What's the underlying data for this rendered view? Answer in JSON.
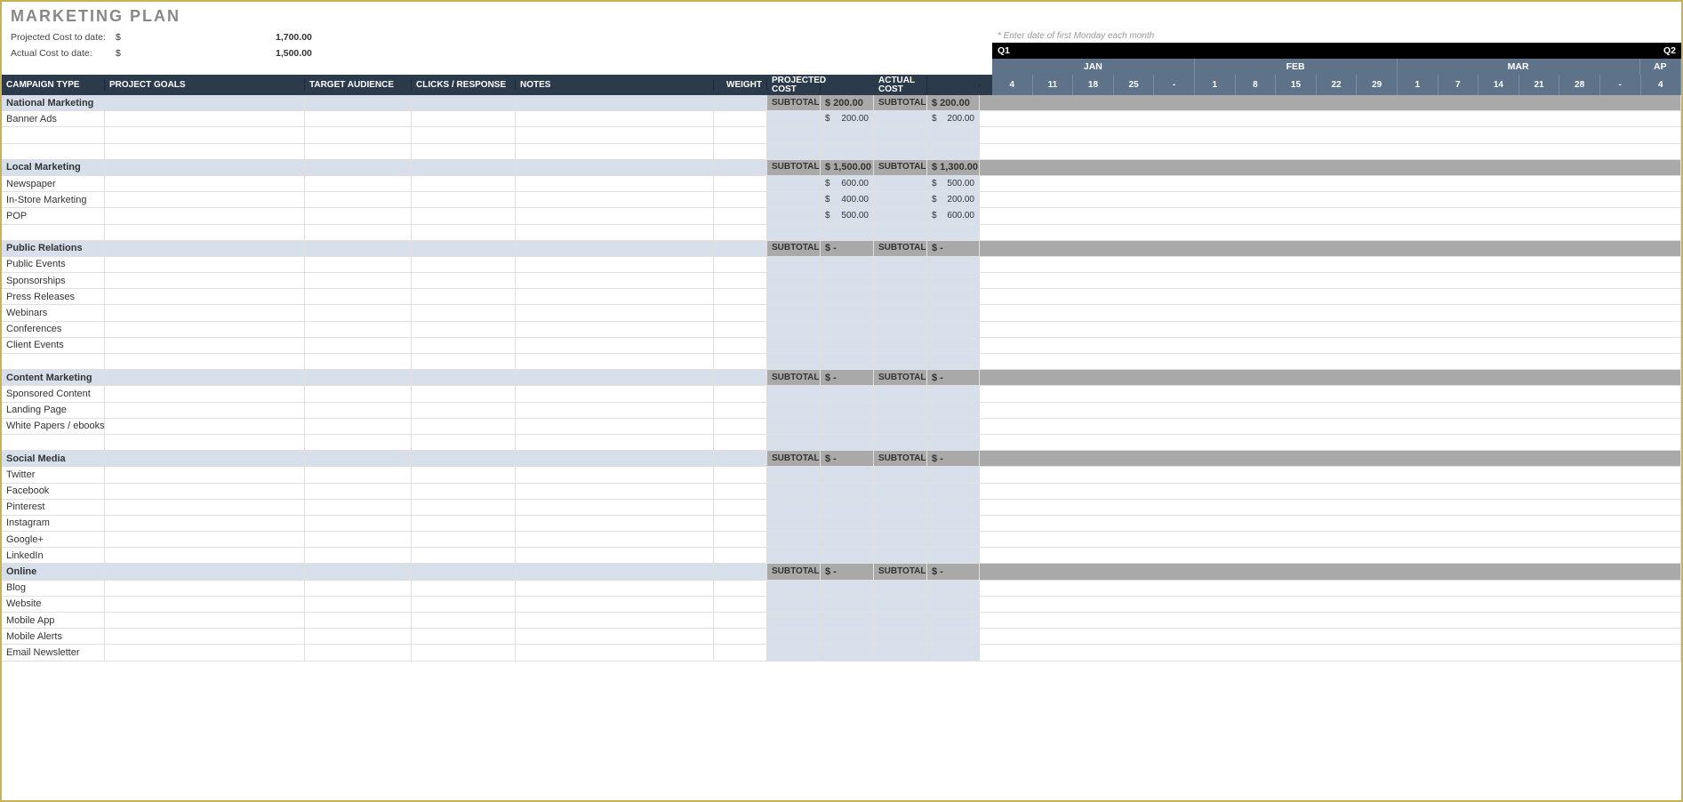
{
  "title": "MARKETING PLAN",
  "summary": {
    "projected_label": "Projected Cost to date:",
    "projected_sym": "$",
    "projected_val": "1,700.00",
    "actual_label": "Actual Cost to date:",
    "actual_sym": "$",
    "actual_val": "1,500.00"
  },
  "right_note": "* Enter date of first Monday each month",
  "quarter_left": "Q1",
  "quarter_right": "Q2",
  "months": [
    "JAN",
    "FEB",
    "MAR",
    "AP"
  ],
  "days": [
    "4",
    "11",
    "18",
    "25",
    "-",
    "1",
    "8",
    "15",
    "22",
    "29",
    "1",
    "7",
    "14",
    "21",
    "28",
    "-",
    "4"
  ],
  "headers": {
    "campaign": "CAMPAIGN TYPE",
    "goals": "PROJECT GOALS",
    "audience": "TARGET AUDIENCE",
    "clicks": "CLICKS / RESPONSE",
    "notes": "NOTES",
    "weight": "WEIGHT",
    "projcost": "PROJECTED COST",
    "actcost": "ACTUAL COST",
    "subtotal": "SUBTOTAL"
  },
  "sections": [
    {
      "name": "National Marketing",
      "proj": "$   200.00",
      "act": "$   200.00",
      "items": [
        {
          "name": "Banner Ads",
          "proj": "200.00",
          "act": "200.00"
        },
        {
          "name": ""
        },
        {
          "name": ""
        }
      ]
    },
    {
      "name": "Local Marketing",
      "proj": "$  1,500.00",
      "act": "$  1,300.00",
      "items": [
        {
          "name": "Newspaper",
          "proj": "600.00",
          "act": "500.00"
        },
        {
          "name": "In-Store Marketing",
          "proj": "400.00",
          "act": "200.00"
        },
        {
          "name": "POP",
          "proj": "500.00",
          "act": "600.00"
        },
        {
          "name": ""
        }
      ]
    },
    {
      "name": "Public Relations",
      "proj": "$           -",
      "act": "$           -",
      "items": [
        {
          "name": "Public Events"
        },
        {
          "name": "Sponsorships"
        },
        {
          "name": "Press Releases"
        },
        {
          "name": "Webinars"
        },
        {
          "name": "Conferences"
        },
        {
          "name": "Client Events"
        },
        {
          "name": ""
        }
      ]
    },
    {
      "name": "Content Marketing",
      "proj": "$           -",
      "act": "$           -",
      "items": [
        {
          "name": "Sponsored Content"
        },
        {
          "name": "Landing Page"
        },
        {
          "name": "White Papers / ebooks"
        },
        {
          "name": ""
        }
      ]
    },
    {
      "name": "Social Media",
      "proj": "$           -",
      "act": "$           -",
      "items": [
        {
          "name": "Twitter"
        },
        {
          "name": "Facebook"
        },
        {
          "name": "Pinterest"
        },
        {
          "name": "Instagram"
        },
        {
          "name": "Google+"
        },
        {
          "name": "LinkedIn"
        }
      ]
    },
    {
      "name": "Online",
      "proj": "$           -",
      "act": "$           -",
      "items": [
        {
          "name": "Blog"
        },
        {
          "name": "Website"
        },
        {
          "name": "Mobile App"
        },
        {
          "name": "Mobile Alerts"
        },
        {
          "name": "Email Newsletter"
        }
      ]
    }
  ]
}
